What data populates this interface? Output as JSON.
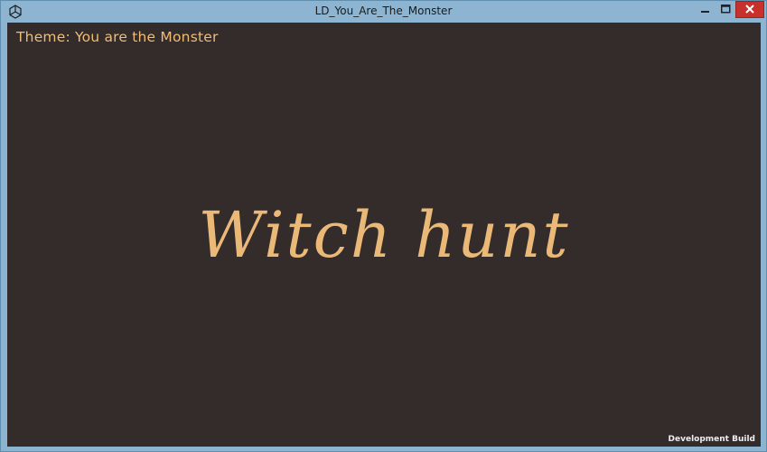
{
  "window": {
    "title": "LD_You_Are_The_Monster",
    "app_icon": "unity-icon",
    "controls": {
      "minimize_icon": "minimize-icon",
      "maximize_icon": "maximize-icon",
      "close_icon": "close-icon"
    }
  },
  "game": {
    "theme_label": "Theme: You are the Monster",
    "title": "Witch hunt",
    "build_label": "Development Build"
  },
  "colors": {
    "background": "#342b2b",
    "accent_text": "#eab977",
    "titlebar": "#8db5d1",
    "close_button": "#c7312b"
  }
}
